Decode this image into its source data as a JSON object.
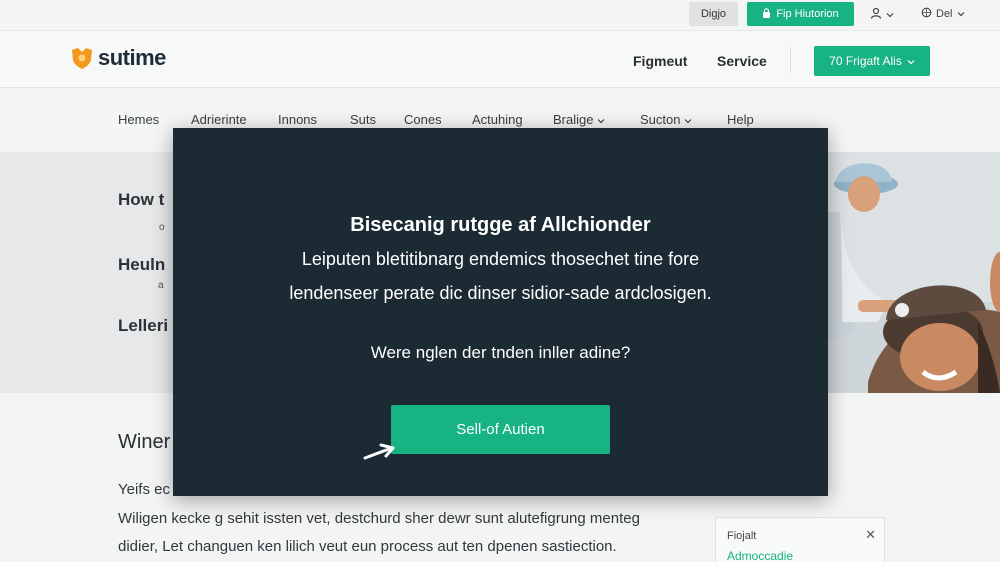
{
  "utility_bar": {
    "grey_button_label": "Digjo",
    "green_button_label": "Fip Hiutorion",
    "user_label": "",
    "lang_label": "Del"
  },
  "header": {
    "logo_text": "sutime",
    "links": [
      "Figmeut",
      "Service"
    ],
    "cta_label": "70 Frigaft Alis"
  },
  "nav": {
    "items": [
      {
        "label": "Hemes",
        "has_dropdown": false
      },
      {
        "label": "Adrierinte",
        "has_dropdown": false
      },
      {
        "label": "Innons",
        "has_dropdown": false
      },
      {
        "label": "Suts",
        "has_dropdown": false
      },
      {
        "label": "Cones",
        "has_dropdown": false
      },
      {
        "label": "Actuhing",
        "has_dropdown": false
      },
      {
        "label": "Bralige",
        "has_dropdown": true
      },
      {
        "label": "Sucton",
        "has_dropdown": true
      },
      {
        "label": "Help",
        "has_dropdown": false
      }
    ]
  },
  "hero": {
    "line1": "How t",
    "sub1": "o",
    "line2": "Heuln",
    "sub2": "a",
    "line3": "Lelleri"
  },
  "lower": {
    "heading": "Winer",
    "para_start": "Yeifs ec",
    "para_line2": "Wiligen kecke g sehit issten vet, destchurd sher dewr sunt alutefigrung menteg",
    "para_line3": "didier, Let changuen ken lilich veut eun process aut ten dpenen sastiection."
  },
  "mini_card": {
    "title": "Fiojalt",
    "link": "Admoccadie"
  },
  "modal": {
    "title": "Bisecanig rutgge af Allchionder",
    "body_line1": "Leiputen bletitibnarg endemics thosechet tine fore",
    "body_line2": "lendenseer perate dic dinser sidior-sade ardclosigen.",
    "question": "Were nglen der tnden inller adine?",
    "button_label": "Sell-of Autien"
  },
  "colors": {
    "accent": "#18b382",
    "modal_bg": "#1b2a33",
    "logo_orange": "#f39a1e"
  },
  "icons": {
    "lock": "lock-icon",
    "user": "user-icon",
    "globe": "globe-icon",
    "chevron": "chevron-down-icon",
    "close": "close-icon",
    "cursor": "cursor-arrow-icon"
  }
}
